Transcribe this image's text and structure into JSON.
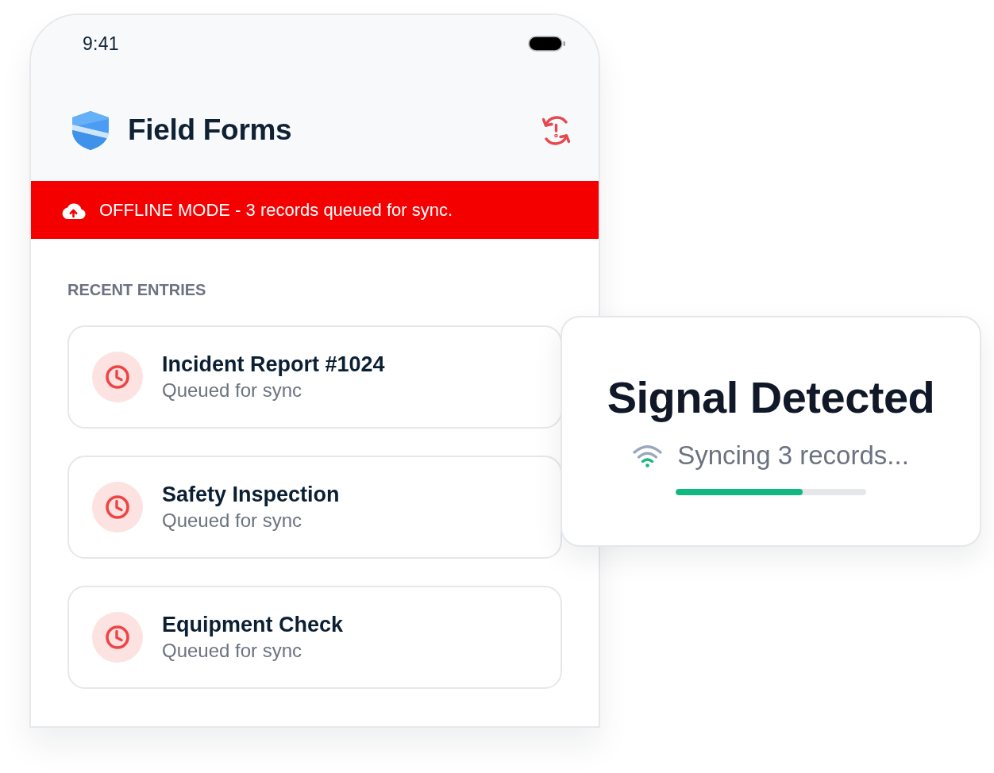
{
  "status_bar": {
    "time": "9:41"
  },
  "header": {
    "title": "Field Forms"
  },
  "banner": {
    "text": "OFFLINE MODE - 3 records queued for sync."
  },
  "recent": {
    "heading": "RECENT ENTRIES",
    "entries": [
      {
        "title": "Incident Report #1024",
        "status": "Queued for sync"
      },
      {
        "title": "Safety Inspection",
        "status": "Queued for sync"
      },
      {
        "title": "Equipment Check",
        "status": "Queued for sync"
      }
    ]
  },
  "sync_card": {
    "title": "Signal Detected",
    "message": "Syncing 3 records...",
    "level": 0.667
  }
}
